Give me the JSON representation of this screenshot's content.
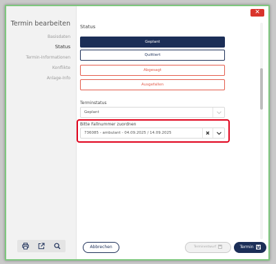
{
  "dialog": {
    "close_label": "✕"
  },
  "sidebar": {
    "title": "Termin bearbeiten",
    "items": [
      {
        "label": "Basisdaten",
        "active": false
      },
      {
        "label": "Status",
        "active": true
      },
      {
        "label": "Termin-Informationen",
        "active": false
      },
      {
        "label": "Konflikte",
        "active": false
      },
      {
        "label": "Anlage-Info",
        "active": false
      }
    ],
    "tools": [
      "print-icon",
      "external-link-icon",
      "search-icon"
    ]
  },
  "main": {
    "status_label": "Status",
    "status_buttons": {
      "geplant": "Geplant",
      "quittiert": "Quittiert",
      "abgesagt": "Abgesagt",
      "ausgefallen": "Ausgefallen"
    },
    "terminstatus": {
      "label": "Terminstatus",
      "value": "Geplant"
    },
    "fallnummer": {
      "label": "Bitte Fallnummer zuordnen",
      "value": "736085 - ambulant - 04.09.2025 / 14.09.2025"
    }
  },
  "footer": {
    "cancel_label": "Abbrechen",
    "draft_label": "Terminentwurf",
    "save_label": "Termin"
  },
  "colors": {
    "primary": "#1b2e57",
    "danger": "#e35a4a",
    "highlight": "#e0001a",
    "close": "#d9342b",
    "border": "#7ec77e"
  }
}
